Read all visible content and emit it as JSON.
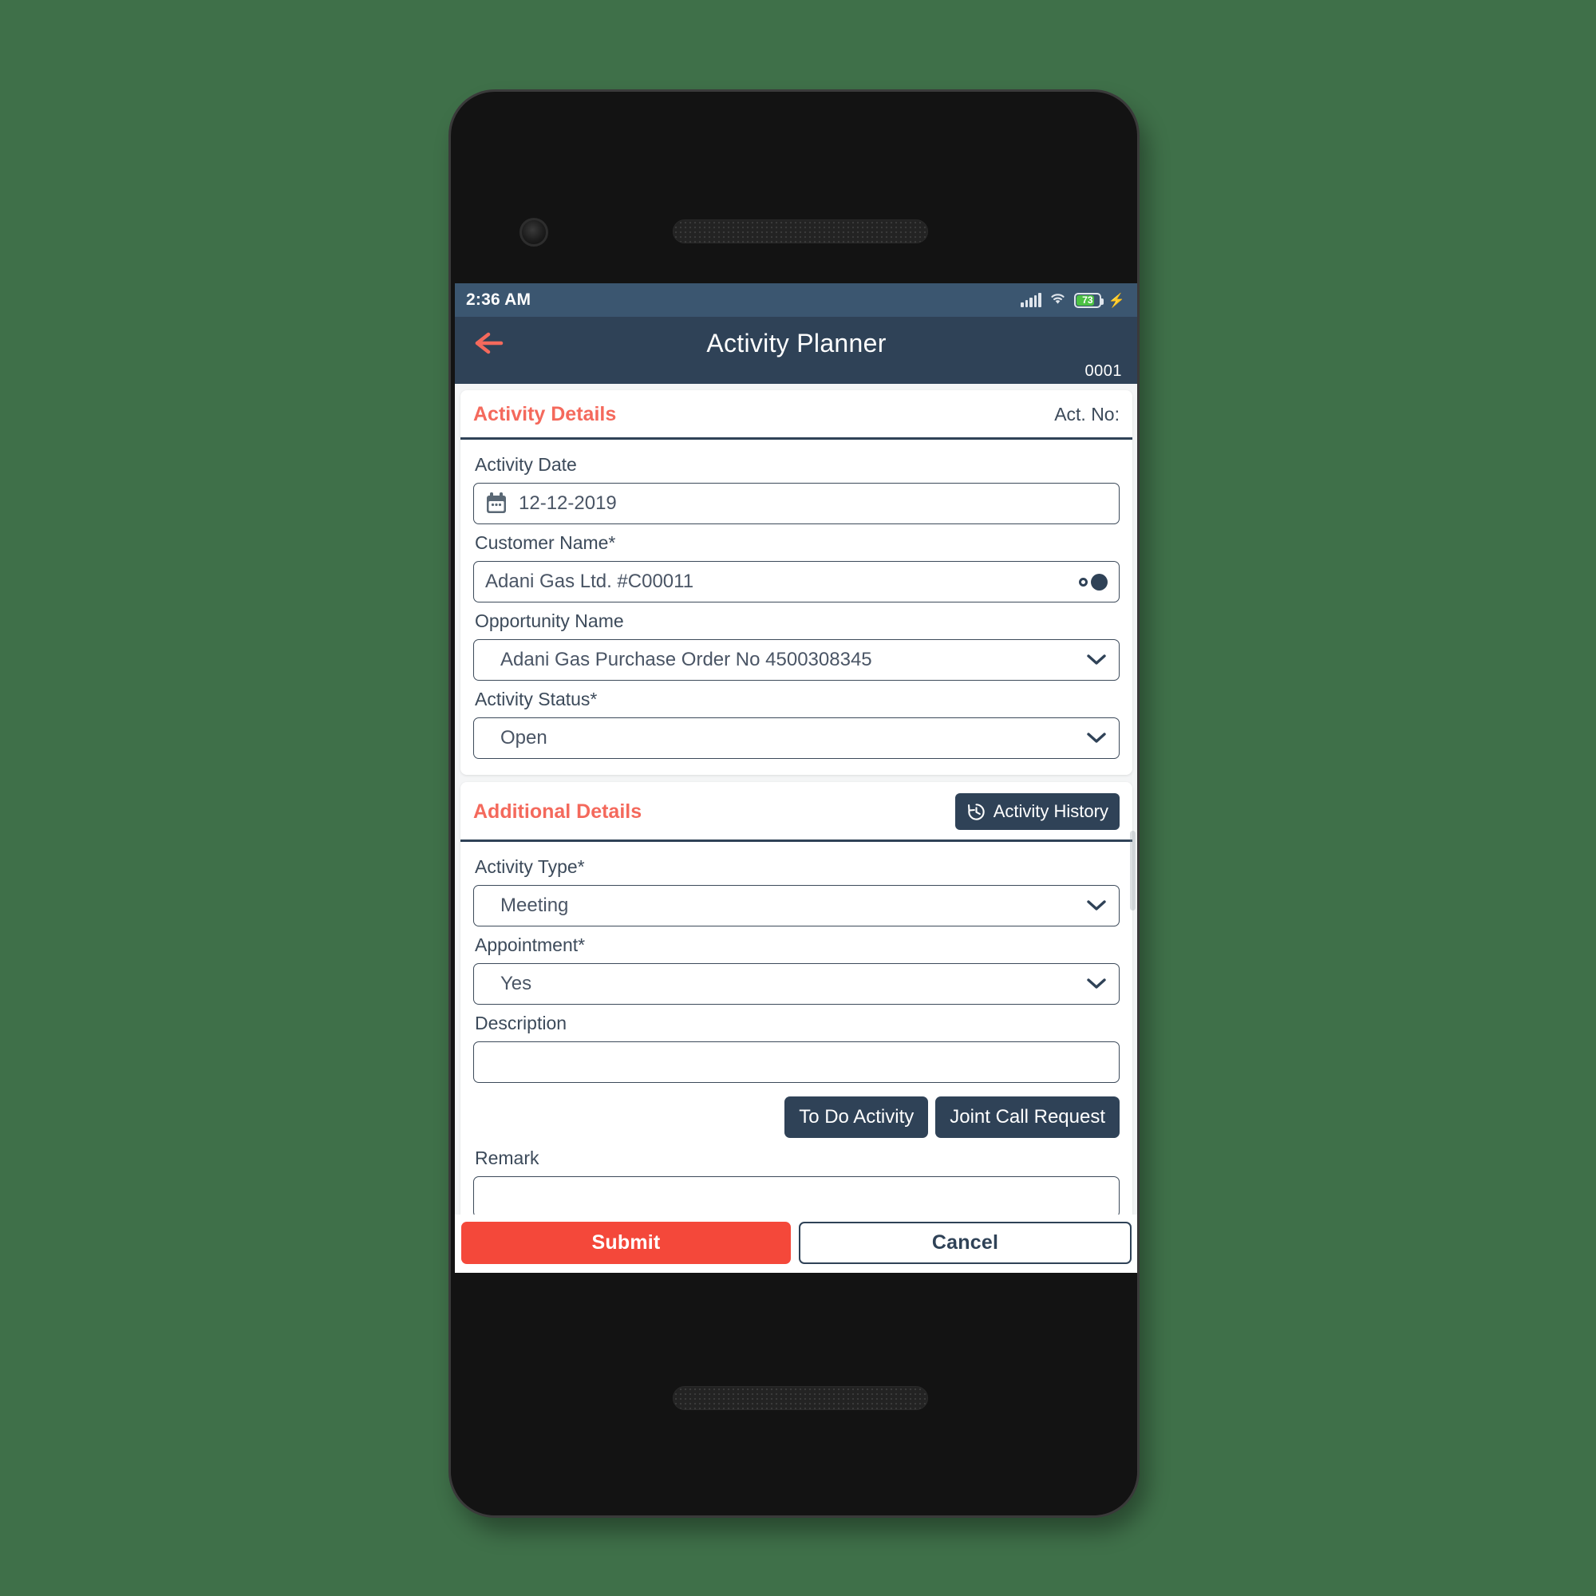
{
  "status_bar": {
    "time": "2:36 AM",
    "signal_icon": "signal-bars-icon",
    "wifi_icon": "wifi-icon",
    "battery_percent": "73",
    "charging_icon": "lightning-bolt-icon"
  },
  "header": {
    "back_icon": "back-arrow-icon",
    "title": "Activity Planner",
    "code": "0001"
  },
  "activity_details": {
    "title": "Activity Details",
    "act_no_label": "Act. No:",
    "fields": {
      "activity_date": {
        "label": "Activity Date",
        "value": "12-12-2019",
        "icon": "calendar-icon"
      },
      "customer_name": {
        "label": "Customer Name*",
        "value": "Adani Gas Ltd. #C00011",
        "icon": "search-lookup-icon"
      },
      "opportunity_name": {
        "label": "Opportunity Name",
        "value": "Adani Gas Purchase Order No 4500308345",
        "icon": "chevron-down-icon"
      },
      "activity_status": {
        "label": "Activity Status*",
        "value": "Open",
        "icon": "chevron-down-icon"
      }
    }
  },
  "additional_details": {
    "title": "Additional Details",
    "history_button": {
      "label": "Activity History",
      "icon": "history-clock-icon"
    },
    "fields": {
      "activity_type": {
        "label": "Activity Type*",
        "value": "Meeting",
        "icon": "chevron-down-icon"
      },
      "appointment": {
        "label": "Appointment*",
        "value": "Yes",
        "icon": "chevron-down-icon"
      },
      "description": {
        "label": "Description",
        "value": "",
        "placeholder": ""
      },
      "remark": {
        "label": "Remark",
        "value": "",
        "placeholder": ""
      }
    },
    "buttons": {
      "todo": "To Do Activity",
      "joint_call": "Joint Call Request"
    }
  },
  "footer": {
    "submit": "Submit",
    "cancel": "Cancel"
  },
  "colors": {
    "accent_coral": "#f4695c",
    "submit_red": "#f4483a",
    "header_navy": "#2f4257",
    "status_bar_blue": "#3b5670",
    "battery_green": "#4cc144",
    "page_background": "#3f7049"
  }
}
